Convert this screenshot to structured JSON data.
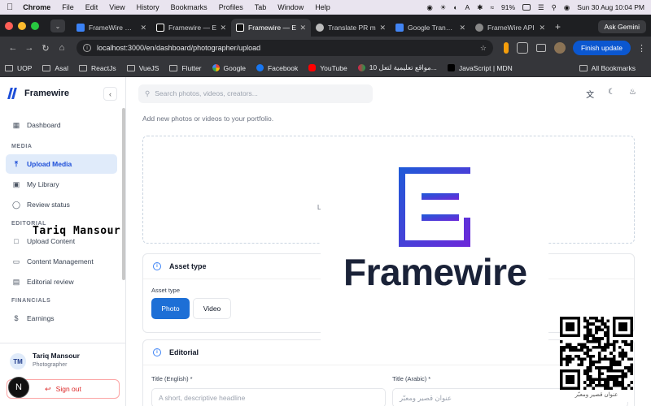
{
  "menubar": {
    "app": "Chrome",
    "items": [
      "File",
      "Edit",
      "View",
      "History",
      "Bookmarks",
      "Profiles",
      "Tab",
      "Window",
      "Help"
    ],
    "battery": "91%",
    "clock": "Sun 30 Aug  10:04 PM"
  },
  "tabs": [
    {
      "label": "FrameWire — V",
      "fav": "#3b82f6"
    },
    {
      "label": "Framewire — E",
      "fav": "#111111"
    },
    {
      "label": "Framewire — E",
      "fav": "#111111",
      "active": true
    },
    {
      "label": "Translate PR m",
      "fav": "#bbbbbb"
    },
    {
      "label": "Google Translat",
      "fav": "#4285f4"
    },
    {
      "label": "FrameWire API",
      "fav": "#888888"
    }
  ],
  "ask_gemini": "Ask Gemini",
  "address": {
    "url": "localhost:3000/en/dashboard/photographer/upload",
    "finish_update": "Finish update"
  },
  "bookmarks": [
    {
      "label": "UOP",
      "icon": "folder-icon"
    },
    {
      "label": "Asal",
      "icon": "folder-icon"
    },
    {
      "label": "ReactJs",
      "icon": "folder-icon"
    },
    {
      "label": "VueJS",
      "icon": "folder-icon"
    },
    {
      "label": "Flutter",
      "icon": "folder-icon"
    },
    {
      "label": "Google",
      "icon": "google-icon"
    },
    {
      "label": "Facebook",
      "icon": "facebook-icon"
    },
    {
      "label": "YouTube",
      "icon": "youtube-icon"
    },
    {
      "label": "10 مواقع تعليمية لتعل...",
      "icon": "site-icon"
    },
    {
      "label": "JavaScript | MDN",
      "icon": "mdn-icon"
    }
  ],
  "all_bookmarks": "All Bookmarks",
  "sidebar": {
    "brand": "Framewire",
    "dashboard": "Dashboard",
    "section_media": "MEDIA",
    "upload_media": "Upload Media",
    "my_library": "My Library",
    "review_status": "Review status",
    "section_editorial": "EDITORIAL",
    "upload_content": "Upload Content",
    "content_management": "Content Management",
    "editorial_review": "Editorial review",
    "section_financials": "FINANCIALS",
    "earnings": "Earnings",
    "user_initials": "TM",
    "user_name": "Tariq Mansour",
    "user_role": "Photographer",
    "sign_out": "Sign out",
    "n_badge": "N"
  },
  "topbar": {
    "search_placeholder": "Search photos, videos, creators..."
  },
  "main": {
    "subtitle": "Add new photos or videos to your portfolio.",
    "dropzone_fragment": "L",
    "asset_type_title": "Asset type",
    "asset_type_label": "Asset type",
    "photo": "Photo",
    "video": "Video",
    "editorial_title": "Editorial",
    "title_en_label": "Title (English) *",
    "title_en_placeholder": "A short, descriptive headline",
    "title_ar_label": "Title (Arabic) *",
    "title_ar_placeholder": "عنوان قصير ومعبّر"
  },
  "overlay": {
    "logo_word": "Framewire",
    "watermark_name": "Tariq Mansour"
  },
  "colors": {
    "accent": "#1d6fd6",
    "active_nav_bg": "#e0ebfa",
    "danger": "#dc2626",
    "logo_text": "#1a2238"
  }
}
